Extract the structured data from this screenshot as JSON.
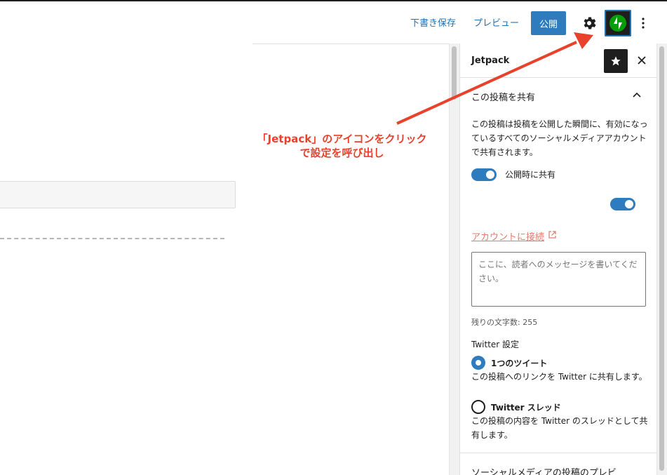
{
  "header": {
    "save_draft": "下書き保存",
    "preview": "プレビュー",
    "publish": "公開"
  },
  "sidebar": {
    "title": "Jetpack",
    "panel_title": "この投稿を共有",
    "description": "この投稿は投稿を公開した瞬間に、有効になっているすべてのソーシャルメディアアカウントで共有されます。",
    "share_on_publish_label": "公開時に共有",
    "connect_link": "アカウントに接続",
    "message_placeholder": "ここに、読者へのメッセージを書いてください。",
    "remaining_chars": "残りの文字数: 255",
    "twitter_settings_title": "Twitter 設定",
    "option_single_label": "1つのツイート",
    "option_single_help": "この投稿へのリンクを Twitter に共有します。",
    "option_thread_label": "Twitter スレッド",
    "option_thread_help": "この投稿の内容を Twitter のスレッドとして共有します。",
    "next_panel_title": "ソーシャルメディアの投稿のプレビ"
  },
  "annotation": {
    "line1": "「Jetpack」のアイコンをクリック",
    "line2": "で設定を呼び出し"
  },
  "colors": {
    "accent": "#2e7bbd",
    "annotation": "#e8412c",
    "jetpack_green": "#069e08"
  },
  "icons": {
    "settings": "gear-icon",
    "jetpack": "jetpack-bolt-icon",
    "more": "vertical-ellipsis-icon",
    "star": "star-icon",
    "close": "close-icon",
    "collapse": "chevron-up-icon",
    "external": "external-link-icon"
  }
}
